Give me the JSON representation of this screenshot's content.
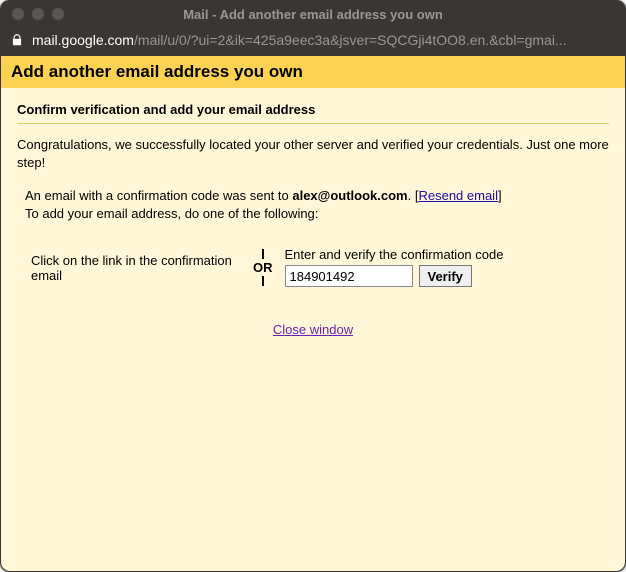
{
  "window": {
    "title": "Mail - Add another email address you own"
  },
  "url": {
    "host": "mail.google.com",
    "path": "/mail/u/0/?ui=2&ik=425a9eec3a&jsver=SQCGji4tOO8.en.&cbl=gmai..."
  },
  "page": {
    "heading": "Add another email address you own",
    "subheading": "Confirm verification and add your email address",
    "congrats": "Congratulations, we successfully located your other server and verified your credentials. Just one more step!",
    "confirmation_prefix": "An email with a confirmation code was sent to ",
    "confirmation_email": "alex@outlook.com",
    "confirmation_suffix1": ". [",
    "resend_label": "Resend email",
    "confirmation_suffix2": "]",
    "instruction_line2": "To add your email address, do one of the following:",
    "option_left": "Click on the link in the confirmation email",
    "or_label": "OR",
    "option_right_label": "Enter and verify the confirmation code",
    "code_value": "184901492",
    "verify_label": "Verify",
    "close_label": "Close window"
  }
}
